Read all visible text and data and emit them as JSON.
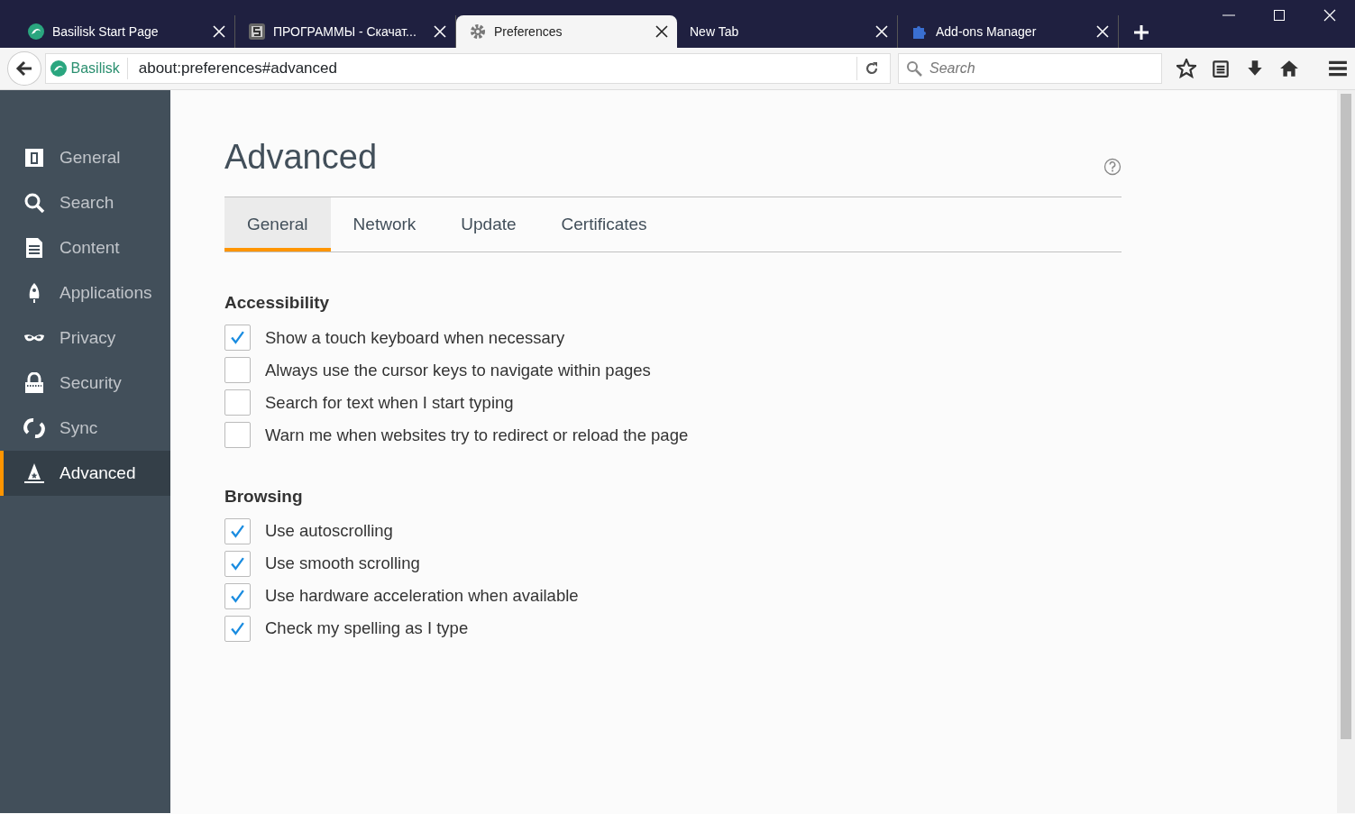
{
  "tabs": [
    {
      "label": "Basilisk Start Page",
      "kind": "logo",
      "selected": false
    },
    {
      "label": "ПРОГРАММЫ - Скачат...",
      "kind": "site",
      "selected": false
    },
    {
      "label": "Preferences",
      "kind": "gear",
      "selected": true
    },
    {
      "label": "New Tab",
      "kind": "none",
      "selected": false
    },
    {
      "label": "Add-ons Manager",
      "kind": "puzzle",
      "selected": false
    }
  ],
  "toolbar": {
    "identity": "Basilisk",
    "url": "about:preferences#advanced",
    "search": {
      "placeholder": "Search"
    }
  },
  "sidebar": {
    "items": [
      {
        "label": "General",
        "kind": "general",
        "selected": false
      },
      {
        "label": "Search",
        "kind": "search",
        "selected": false
      },
      {
        "label": "Content",
        "kind": "content",
        "selected": false
      },
      {
        "label": "Applications",
        "kind": "applications",
        "selected": false
      },
      {
        "label": "Privacy",
        "kind": "privacy",
        "selected": false
      },
      {
        "label": "Security",
        "kind": "security",
        "selected": false
      },
      {
        "label": "Sync",
        "kind": "sync",
        "selected": false
      },
      {
        "label": "Advanced",
        "kind": "advanced",
        "selected": true
      }
    ]
  },
  "page": {
    "title": "Advanced",
    "tabs": [
      {
        "label": "General",
        "selected": true
      },
      {
        "label": "Network",
        "selected": false
      },
      {
        "label": "Update",
        "selected": false
      },
      {
        "label": "Certificates",
        "selected": false
      }
    ],
    "sections": [
      {
        "title": "Accessibility",
        "options": [
          {
            "label": "Show a touch keyboard when necessary",
            "checked": true
          },
          {
            "label": "Always use the cursor keys to navigate within pages",
            "checked": false
          },
          {
            "label": "Search for text when I start typing",
            "checked": false
          },
          {
            "label": "Warn me when websites try to redirect or reload the page",
            "checked": false
          }
        ]
      },
      {
        "title": "Browsing",
        "options": [
          {
            "label": "Use autoscrolling",
            "checked": true
          },
          {
            "label": "Use smooth scrolling",
            "checked": true
          },
          {
            "label": "Use hardware acceleration when available",
            "checked": true
          },
          {
            "label": "Check my spelling as I type",
            "checked": true
          }
        ]
      }
    ]
  }
}
